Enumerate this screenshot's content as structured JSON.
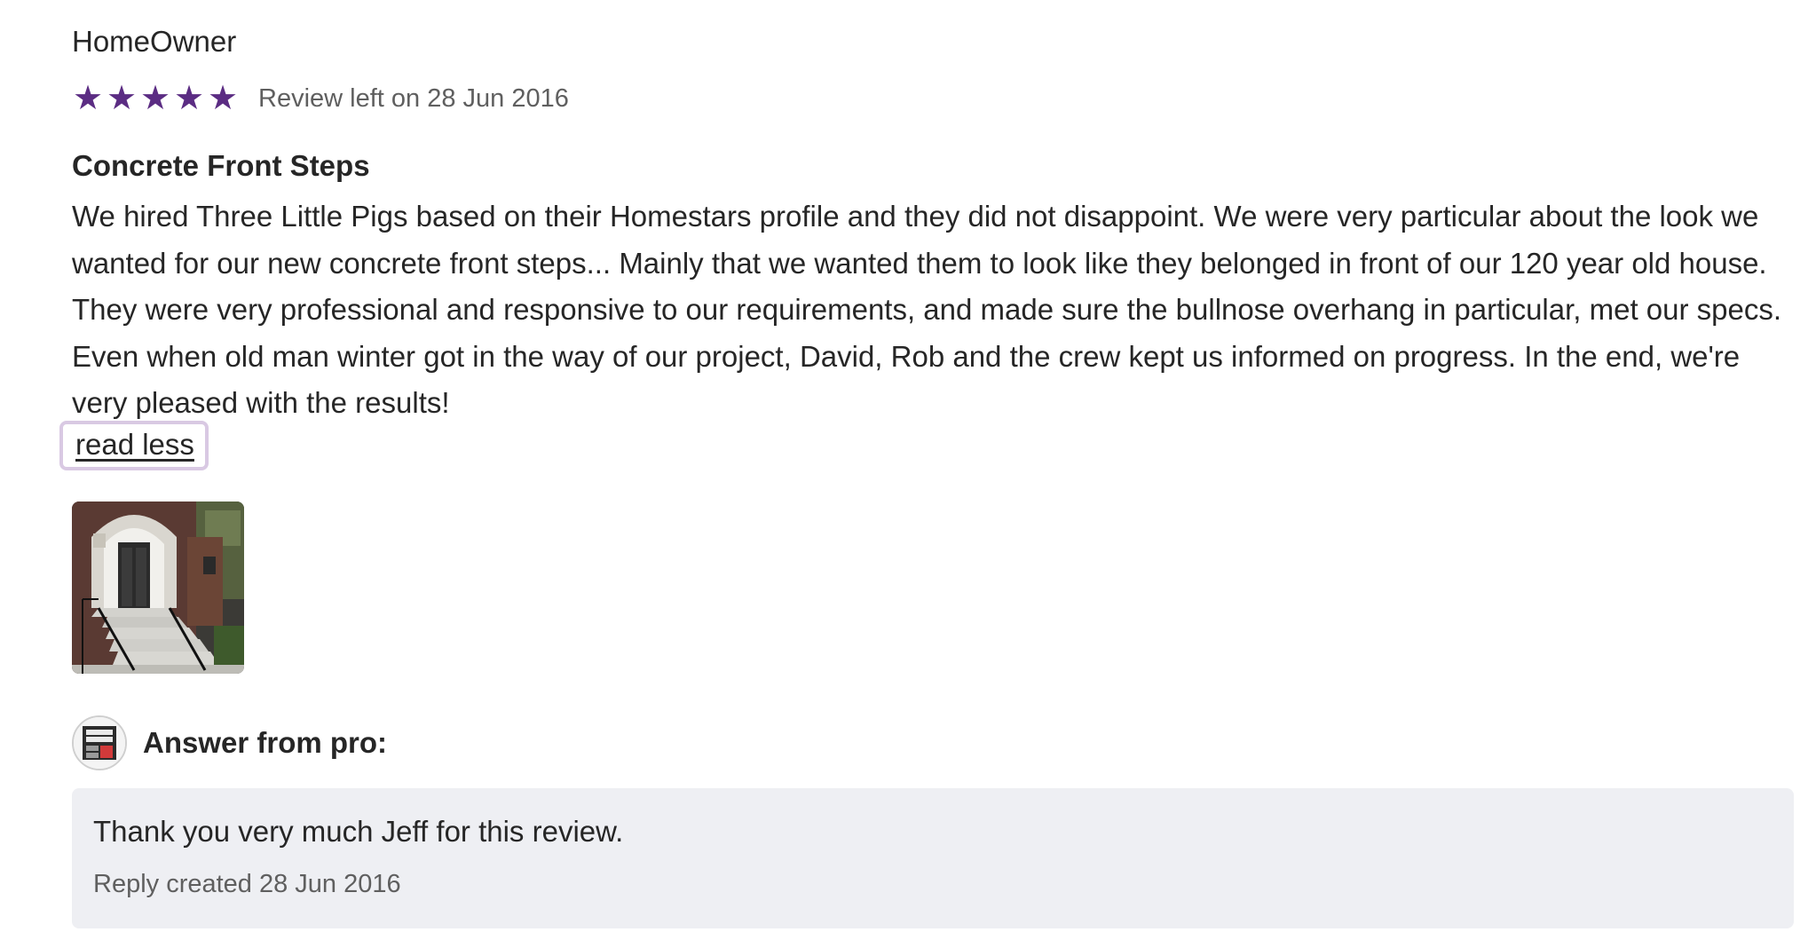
{
  "review": {
    "reviewer": "HomeOwner",
    "rating": 5,
    "rating_max": 5,
    "star_color": "#5b2c83",
    "date_label": "Review left on 28 Jun 2016",
    "title": "Concrete Front Steps",
    "body": "We hired Three Little Pigs based on their Homestars profile and they did not disappoint. We were very particular about the look we wanted for our new concrete front steps... Mainly that we wanted them to look like they belonged in front of our 120 year old house. They were very professional and responsive to our requirements, and made sure the bullnose overhang in particular, met our specs. Even when old man winter got in the way of our project, David, Rob and the crew kept us informed on progress. In the end, we're very pleased with the results!",
    "read_less_label": "read less"
  },
  "answer": {
    "label": "Answer from pro:",
    "reply_text": "Thank you very much Jeff for this review.",
    "reply_date": "Reply created 28 Jun 2016"
  }
}
